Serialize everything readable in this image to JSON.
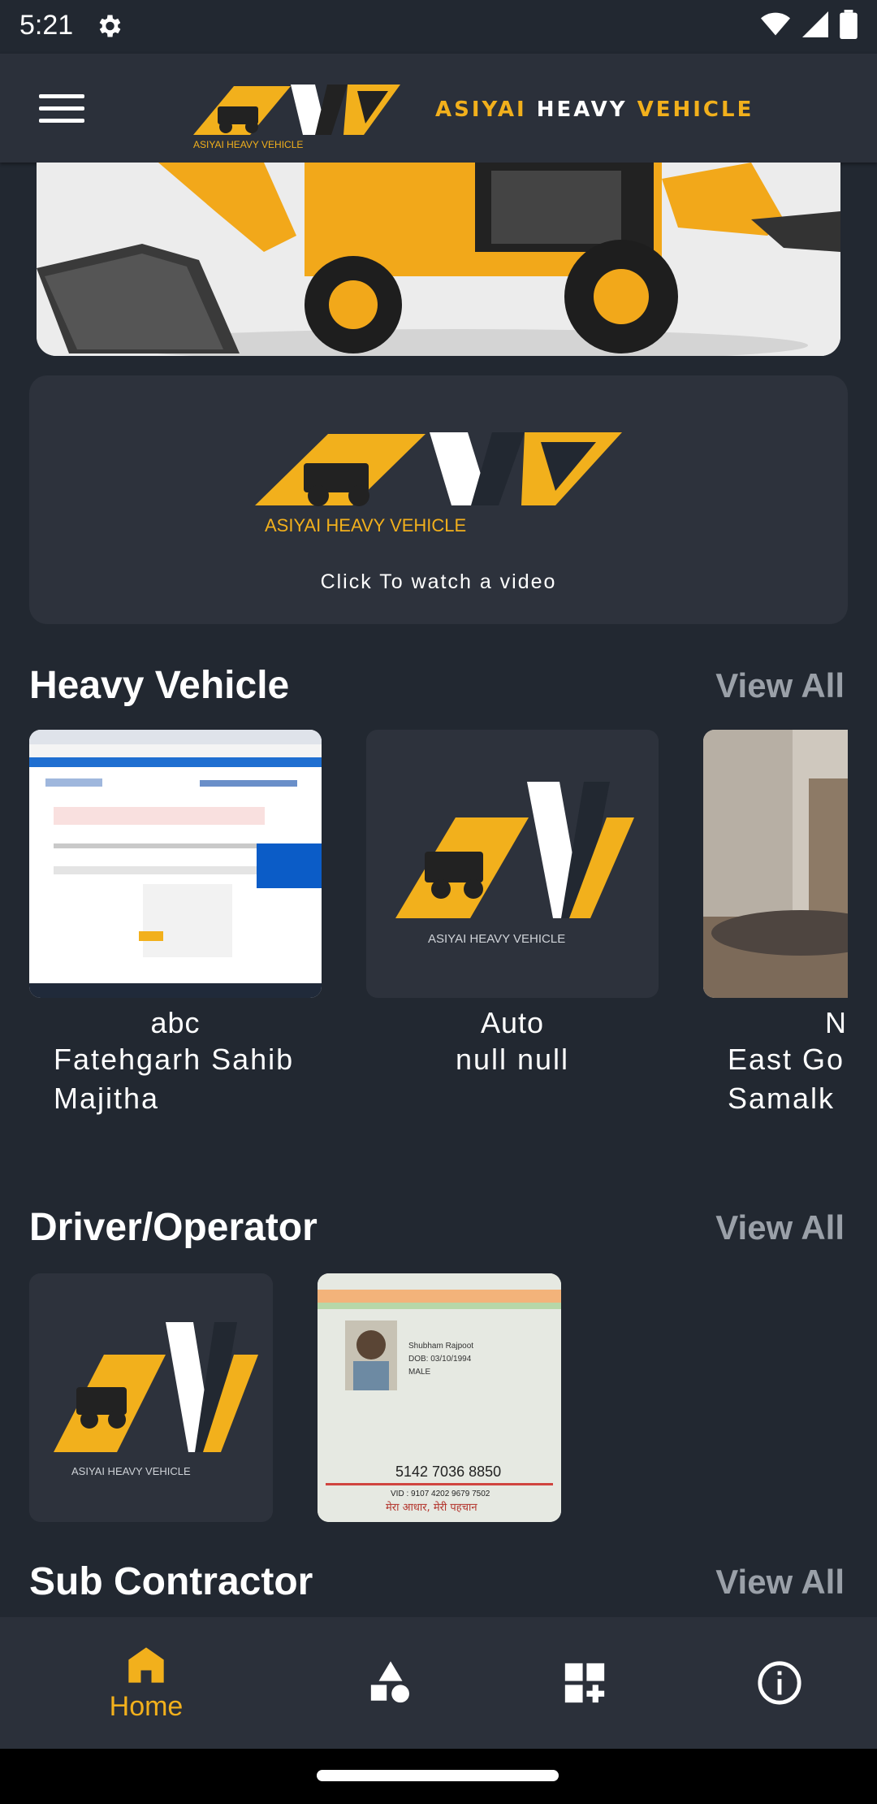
{
  "status_bar": {
    "time": "5:21"
  },
  "app_bar": {
    "logo_text": "ASIYAI HEAVY VEHICLE",
    "brand_parts": [
      "ASIYAI",
      "HEAVY",
      "VEHICLE"
    ]
  },
  "video_card": {
    "logo_text": "ASIYAI HEAVY VEHICLE",
    "caption": "Click To watch a video"
  },
  "heavy_vehicle": {
    "title": "Heavy Vehicle",
    "view_all": "View All",
    "items": [
      {
        "name": "abc",
        "line1": "Fatehgarh Sahib",
        "line2": "Majitha"
      },
      {
        "name": "Auto",
        "line1": "null null",
        "line2": "",
        "logo_text": "ASIYAI HEAVY VEHICLE"
      },
      {
        "name": "N",
        "line1": "East Go",
        "line2": "Samalk"
      }
    ]
  },
  "driver_operator": {
    "title": "Driver/Operator",
    "view_all": "View All",
    "logo_text": "ASIYAI HEAVY VEHICLE",
    "id_card": {
      "name": "Shubham Rajpoot",
      "dob": "DOB: 03/10/1994",
      "gender": "MALE",
      "number": "5142 7036 8850",
      "vid": "VID : 9107 4202 9679 7502",
      "tagline": "मेरा आधार, मेरी पहचान"
    }
  },
  "sub_contractor": {
    "title": "Sub Contractor",
    "view_all": "View All"
  },
  "bottom_nav": {
    "active_color": "#f2b01c",
    "items": [
      {
        "label": "Home",
        "icon": "home-icon"
      },
      {
        "label": "",
        "icon": "shapes-icon"
      },
      {
        "label": "",
        "icon": "add-widget-icon"
      },
      {
        "label": "",
        "icon": "info-icon"
      }
    ]
  },
  "colors": {
    "background": "#222831",
    "card": "#2d323c",
    "accent": "#f2b01c",
    "muted": "#9aa0a8"
  }
}
